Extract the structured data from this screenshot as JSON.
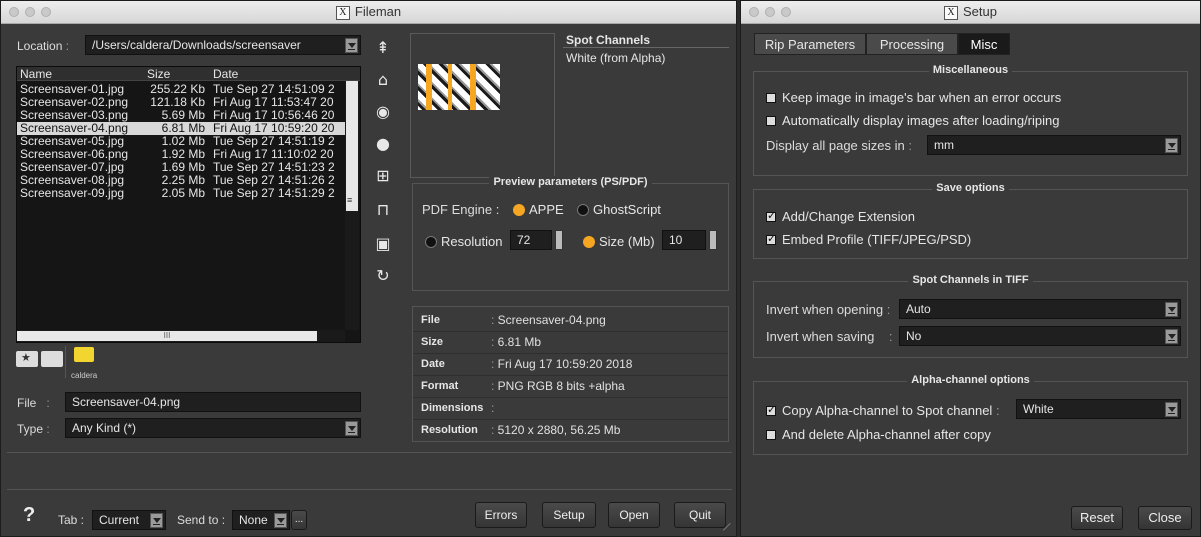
{
  "fileman": {
    "title": "Fileman",
    "location_label": "Location",
    "location_value": "/Users/caldera/Downloads/screensaver",
    "columns": [
      "Name",
      "Size",
      "Date"
    ],
    "files": [
      {
        "name": "Screensaver-01.jpg",
        "size": "255.22 Kb",
        "date": "Tue Sep 27 14:51:09 2"
      },
      {
        "name": "Screensaver-02.png",
        "size": "121.18 Kb",
        "date": "Fri Aug 17 11:53:47 20"
      },
      {
        "name": "Screensaver-03.png",
        "size": "5.69 Mb",
        "date": "Fri Aug 17 10:56:46 20"
      },
      {
        "name": "Screensaver-04.png",
        "size": "6.81 Mb",
        "date": "Fri Aug 17 10:59:20 20"
      },
      {
        "name": "Screensaver-05.jpg",
        "size": "1.02 Mb",
        "date": "Tue Sep 27 14:51:19 2"
      },
      {
        "name": "Screensaver-06.png",
        "size": "1.92 Mb",
        "date": "Fri Aug 17 11:10:02 20"
      },
      {
        "name": "Screensaver-07.jpg",
        "size": "1.69 Mb",
        "date": "Tue Sep 27 14:51:23 2"
      },
      {
        "name": "Screensaver-08.jpg",
        "size": "2.25 Mb",
        "date": "Tue Sep 27 14:51:26 2"
      },
      {
        "name": "Screensaver-09.jpg",
        "size": "2.05 Mb",
        "date": "Tue Sep 27 14:51:29 2"
      }
    ],
    "selected_index": 3,
    "scroll_grip": "III",
    "folder_label": "caldera",
    "file_label": "File",
    "file_value": "Screensaver-04.png",
    "type_label": "Type",
    "type_value": "Any Kind (*)",
    "spot_channels_title": "Spot Channels",
    "spot_channels_value": "White (from Alpha)",
    "preview_title": "Preview parameters (PS/PDF)",
    "pdf_engine_label": "PDF Engine :",
    "engine_appe": "APPE",
    "engine_ghostscript": "GhostScript",
    "resolution_label": "Resolution",
    "resolution_value": "72",
    "size_label": "Size (Mb)",
    "size_value": "10",
    "info": {
      "file_key": "File",
      "file_val": "Screensaver-04.png",
      "size_key": "Size",
      "size_val": "6.81 Mb",
      "date_key": "Date",
      "date_val": "Fri Aug 17 10:59:20 2018",
      "format_key": "Format",
      "format_val": "PNG RGB 8 bits +alpha",
      "dimensions_key": "Dimensions",
      "dimensions_val": "",
      "resolution_key": "Resolution",
      "resolution_val": "5120 x 2880, 56.25 Mb"
    },
    "bottom": {
      "help": "?",
      "tab_label": "Tab :",
      "tab_value": "Current",
      "sendto_label": "Send to :",
      "sendto_value": "None",
      "ellipsis": "...",
      "errors": "Errors",
      "setup": "Setup",
      "open": "Open",
      "quit": "Quit"
    },
    "side_icons": [
      "home-up-icon",
      "home-icon",
      "compass-icon",
      "disc-icon",
      "network-icon",
      "drive-icon",
      "new-folder-icon",
      "refresh-icon"
    ]
  },
  "setup": {
    "title": "Setup",
    "tabs": [
      "Rip Parameters",
      "Processing",
      "Misc"
    ],
    "active_tab": 2,
    "misc": {
      "title": "Miscellaneous",
      "keep_image": "Keep image in image's bar when an error occurs",
      "auto_display": "Automatically display images after loading/riping",
      "page_sizes_label": "Display all page sizes in",
      "page_sizes_value": "mm"
    },
    "save": {
      "title": "Save options",
      "add_ext": "Add/Change Extension",
      "embed_profile": "Embed Profile (TIFF/JPEG/PSD)"
    },
    "spot": {
      "title": "Spot Channels in TIFF",
      "invert_open_label": "Invert when opening",
      "invert_open_value": "Auto",
      "invert_save_label": "Invert when saving",
      "invert_save_value": "No"
    },
    "alpha": {
      "title": "Alpha-channel options",
      "copy_label": "Copy Alpha-channel to Spot channel",
      "copy_value": "White",
      "delete_label": "And delete Alpha-channel after copy"
    },
    "reset": "Reset",
    "close": "Close"
  }
}
